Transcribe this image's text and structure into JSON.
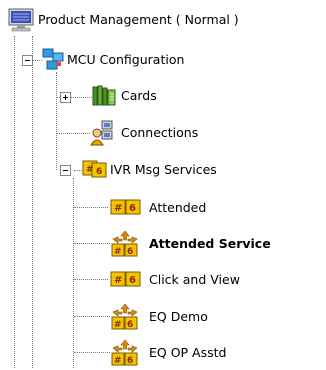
{
  "tree": {
    "root": {
      "label": "Product Management  ( Normal )",
      "icon": "monitor-icon"
    },
    "mcu": {
      "label": "MCU Configuration",
      "icon": "network-icon"
    },
    "cards": {
      "label": "Cards",
      "icon": "cards-icon",
      "state": "collapsed"
    },
    "connections": {
      "label": "Connections",
      "icon": "connections-icon"
    },
    "ivr": {
      "label": "IVR Msg Services",
      "icon": "ivr-services-icon",
      "state": "expanded"
    },
    "services": [
      {
        "label": "Attended",
        "icon": "ivr-service-icon",
        "bold": false
      },
      {
        "label": "Attended Service",
        "icon": "ivr-default-service-icon",
        "bold": true
      },
      {
        "label": "Click and View",
        "icon": "ivr-service-icon",
        "bold": false
      },
      {
        "label": "EQ Demo",
        "icon": "ivr-default-service-icon",
        "bold": false
      },
      {
        "label": "EQ OP Asstd",
        "icon": "ivr-default-service-icon",
        "bold": false
      }
    ]
  }
}
